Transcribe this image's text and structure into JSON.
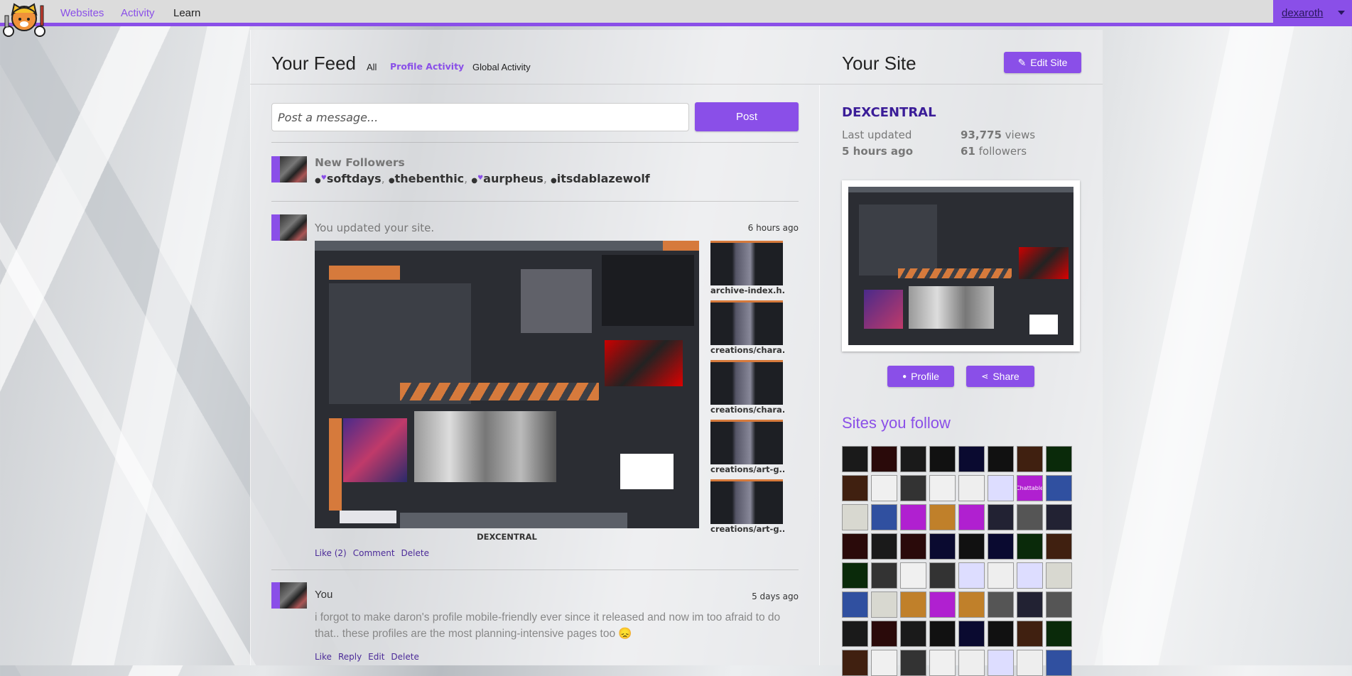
{
  "nav": {
    "links": [
      {
        "label": "Websites",
        "color": "#8a4fe8"
      },
      {
        "label": "Activity",
        "color": "#8a4fe8"
      },
      {
        "label": "Learn",
        "color": "#222"
      }
    ],
    "user": "dexaroth"
  },
  "feed": {
    "title": "Your Feed",
    "tabs": [
      "All",
      "Profile Activity",
      "Global Activity"
    ],
    "active_tab": "Profile Activity",
    "input_placeholder": "Post a message...",
    "post_label": "Post",
    "items": [
      {
        "type": "followers",
        "title": "New Followers",
        "followers": [
          {
            "name": "softdays",
            "mutual": true
          },
          {
            "name": "thebenthic",
            "mutual": false
          },
          {
            "name": "aurpheus",
            "mutual": true
          },
          {
            "name": "itsdablazewolf",
            "mutual": false
          }
        ]
      },
      {
        "type": "update",
        "title": "You updated your site.",
        "time": "6 hours ago",
        "site_caption": "DEXCENTRAL",
        "files": [
          "archive-index.h...",
          "creations/chara...",
          "creations/chara...",
          "creations/art-g...",
          "creations/art-g..."
        ],
        "actions": [
          "Like (2)",
          "Comment",
          "Delete"
        ]
      },
      {
        "type": "post",
        "author": "You",
        "time": "5 days ago",
        "text": "i forgot to make daron's profile mobile-friendly ever since it released and now im too afraid to do that.. these profiles are the most planning-intensive pages too 😞",
        "actions": [
          "Like",
          "Reply",
          "Edit",
          "Delete"
        ]
      }
    ]
  },
  "site": {
    "title": "Your Site",
    "edit_label": "Edit Site",
    "name": "DEXCENTRAL",
    "last_updated_label": "Last updated",
    "last_updated": "5 hours ago",
    "views": "93,775",
    "views_label": "views",
    "followers": "61",
    "followers_label": "followers",
    "profile_label": "Profile",
    "share_label": "Share"
  },
  "follow": {
    "title": "Sites you follow",
    "labeled_site": "Chattable",
    "count_visible": 64
  },
  "colors": {
    "accent": "#8a4fe8",
    "link": "#4b2a98",
    "site_name": "#3b1d98"
  }
}
